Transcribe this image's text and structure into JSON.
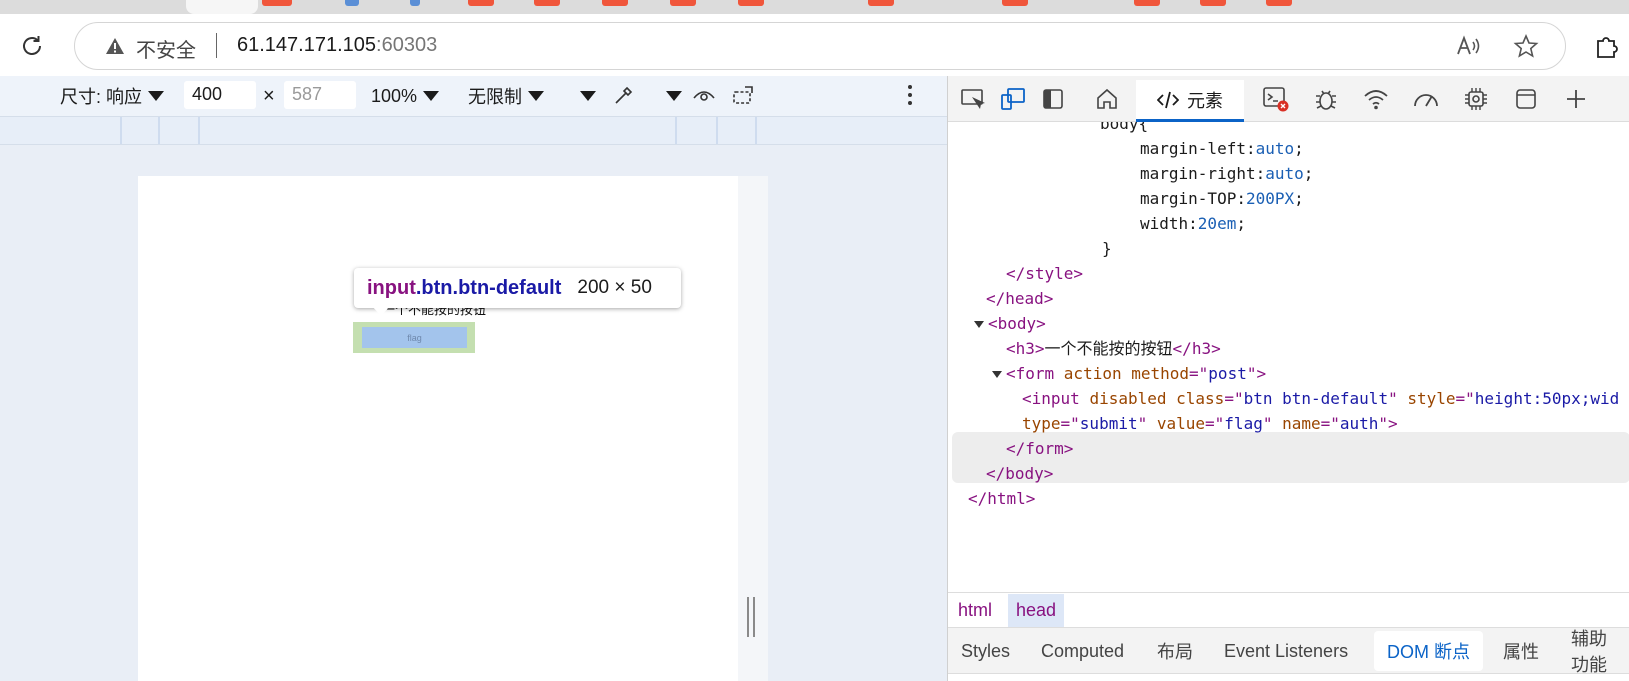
{
  "browser": {
    "address": {
      "security_label": "不安全",
      "url_host": "61.147.171.105",
      "url_port": ":60303"
    }
  },
  "device_toolbar": {
    "dimensions_label": "尺寸: 响应",
    "width_value": "400",
    "times": "×",
    "height_value": "587",
    "zoom": "100%",
    "throttle": "无限制"
  },
  "page": {
    "h3": "一个不能按的按钮",
    "button_value": "flag"
  },
  "tooltip": {
    "tag": "input",
    "classes": ".btn.btn-default",
    "size": "200 × 50"
  },
  "devtools": {
    "elements_tab": "元素",
    "code_lines": {
      "l0": "body{",
      "l1a": "margin-left:",
      "l1b": "auto",
      "l1c": ";",
      "l2a": "margin-right:",
      "l2b": "auto",
      "l2c": ";",
      "l3a": "margin-TOP:",
      "l3b": "200PX",
      "l3c": ";",
      "l4a": "width:",
      "l4b": "20em",
      "l4c": ";",
      "l5": "}",
      "l6": "</style>",
      "l7": "</head>",
      "l8": "<body>",
      "l9a": "<h3>",
      "l9b": "一个不能按的按钮",
      "l9c": "</h3>",
      "l10a": "<form ",
      "l10b": "action ",
      "l10c": "method",
      "l10d": "=\"",
      "l10e": "post",
      "l10f": "\">",
      "l11a": "<input ",
      "l11b": "disabled ",
      "l11c": "class",
      "l11d": "=\"",
      "l11e": "btn btn-default",
      "l11f": "\" ",
      "l11g": "style",
      "l11h": "=\"",
      "l11i": "height:50px;wid",
      "l12a": "type",
      "l12b": "=\"",
      "l12c": "submit",
      "l12d": "\" ",
      "l12e": "value",
      "l12f": "=\"",
      "l12g": "flag",
      "l12h": "\" ",
      "l12i": "name",
      "l12j": "=\"",
      "l12k": "auth",
      "l12l": "\">",
      "l13": "</form>",
      "l14": "</body>",
      "l15": "</html>"
    },
    "breadcrumbs": [
      "html",
      "head"
    ],
    "sub_tabs": [
      "Styles",
      "Computed",
      "布局",
      "Event Listeners",
      "DOM 断点",
      "属性",
      "辅助功能"
    ],
    "selected_sub_tab": "DOM 断点"
  },
  "colors": {
    "accent": "#0b63c7",
    "tag": "#881280",
    "attr": "#994500",
    "value": "#1a1aa6"
  }
}
